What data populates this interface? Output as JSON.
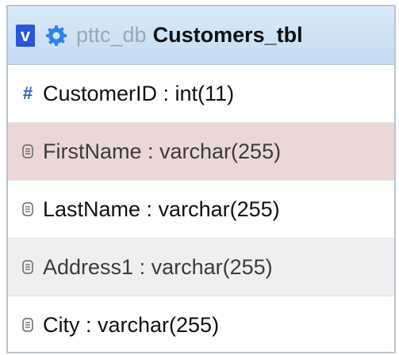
{
  "header": {
    "toggle_label": "v",
    "db_name": "pttc_db",
    "table_name": "Customers_tbl",
    "icon": "gear-icon"
  },
  "columns": [
    {
      "label": "CustomerID : int(11)",
      "icon": "hash-icon",
      "icon_text": "#"
    },
    {
      "label": "FirstName : varchar(255)",
      "icon": "text-field-icon"
    },
    {
      "label": "LastName : varchar(255)",
      "icon": "text-field-icon"
    },
    {
      "label": "Address1 : varchar(255)",
      "icon": "text-field-icon"
    },
    {
      "label": "City : varchar(255)",
      "icon": "text-field-icon"
    }
  ],
  "colors": {
    "accent": "#2b55d7",
    "header_bg": "#d9e9f8",
    "highlight_row": "#ecd7d7",
    "alt_row": "#efefef"
  }
}
